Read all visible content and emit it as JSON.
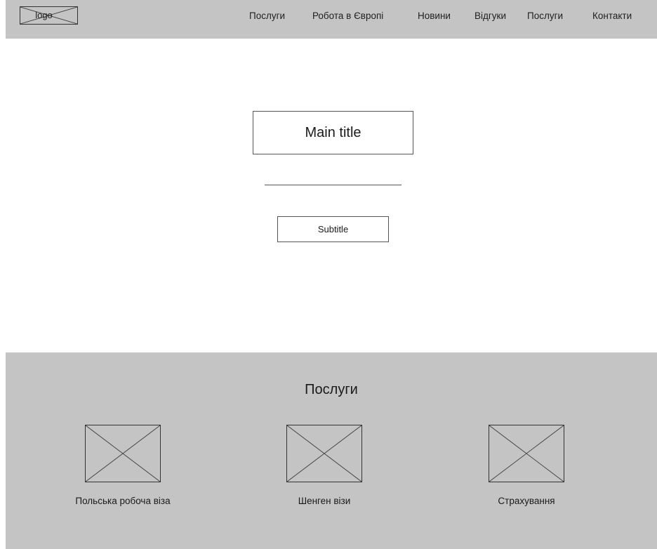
{
  "header": {
    "logo_text": "logo",
    "nav": [
      {
        "label": "Послуги"
      },
      {
        "label": "Робота в Європі"
      },
      {
        "label": "Новини"
      },
      {
        "label": "Відгуки"
      },
      {
        "label": "Послуги"
      },
      {
        "label": "Контакти"
      }
    ]
  },
  "hero": {
    "main_title": "Main title",
    "subtitle": "Subtitle"
  },
  "services": {
    "title": "Послуги",
    "items": [
      {
        "label": "Польська робоча віза"
      },
      {
        "label": "Шенген візи"
      },
      {
        "label": "Страхування"
      }
    ]
  },
  "colors": {
    "header_bg": "#c4c4c4",
    "section_bg": "#c4c4c4",
    "page_bg": "#ffffff"
  }
}
